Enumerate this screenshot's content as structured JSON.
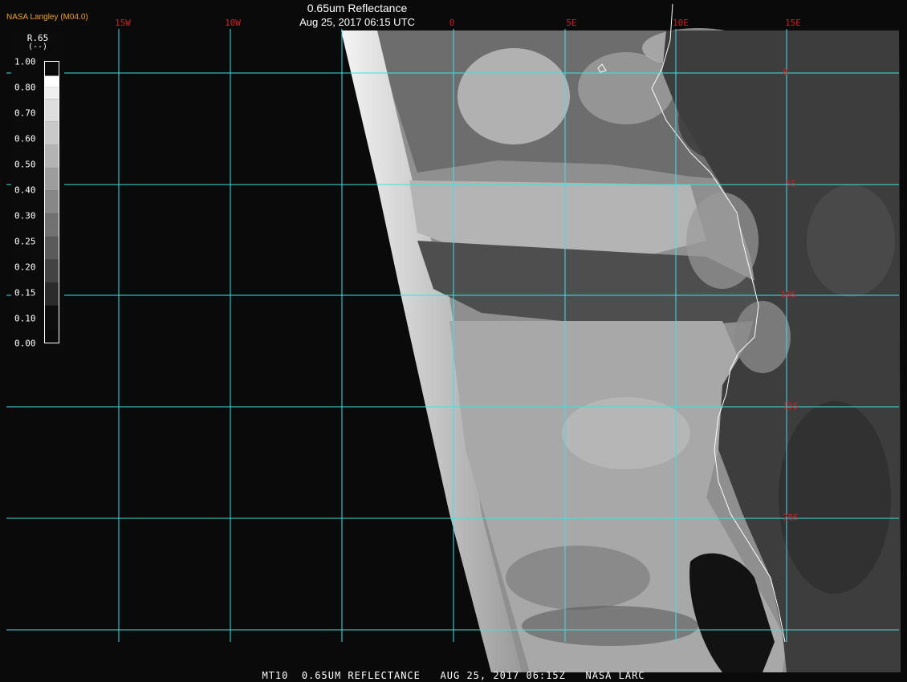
{
  "header": {
    "brand": "NASA Langley (M04.0)",
    "title": "0.65um Reflectance",
    "subtitle": "Aug 25, 2017 06:15 UTC"
  },
  "grid": {
    "longitude_labels": [
      "15W",
      "10W",
      "0",
      "5E",
      "10E",
      "15E"
    ],
    "latitude_labels": [
      "0",
      "5S",
      "10S",
      "15S",
      "20S"
    ],
    "line_color": "#3ee0e6"
  },
  "colorbar": {
    "title": "R.65",
    "unit": "(--)",
    "ticks": [
      "1.00",
      "0.80",
      "0.70",
      "0.60",
      "0.50",
      "0.40",
      "0.30",
      "0.25",
      "0.20",
      "0.15",
      "0.10",
      "0.00"
    ]
  },
  "footer": "MT10  0.65UM REFLECTANCE   AUG 25, 2017 06:15Z   NASA LARC",
  "colors": {
    "background": "#000000",
    "label_red": "#d02020",
    "brand_orange": "#f0a030",
    "coastline": "#ffffff"
  }
}
